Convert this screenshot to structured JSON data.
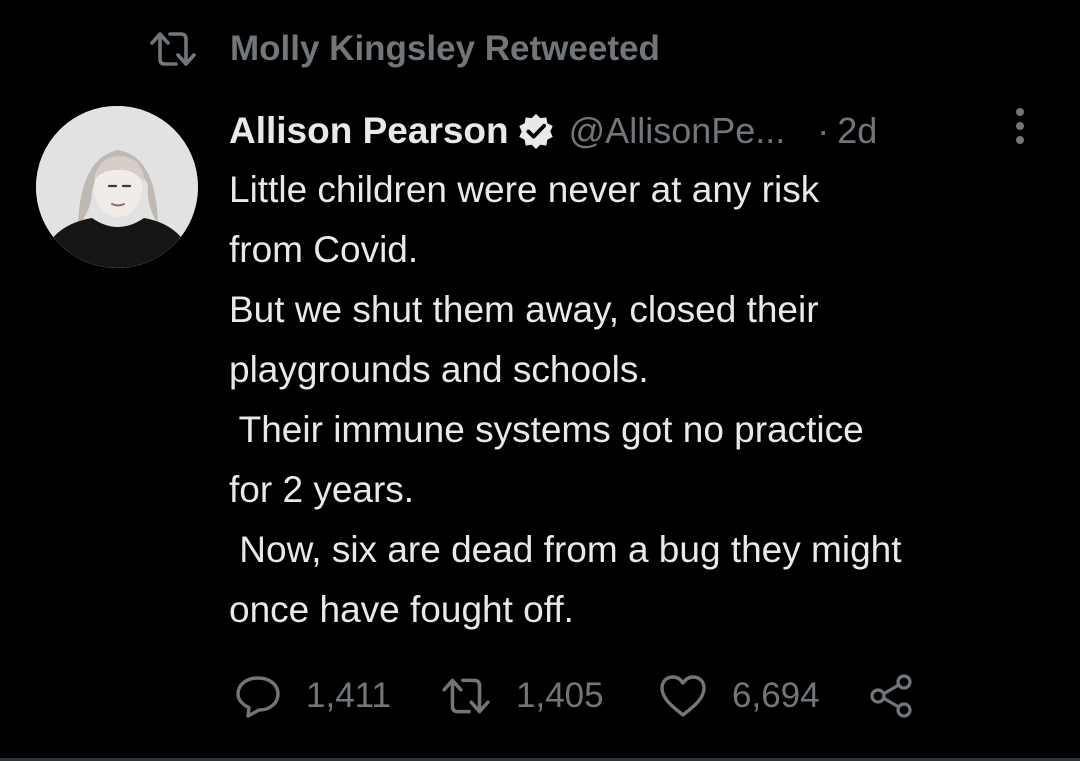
{
  "retweet_context": {
    "text": "Molly Kingsley Retweeted",
    "icon": "retweet-icon"
  },
  "tweet": {
    "author_name": "Allison Pearson",
    "verified": true,
    "handle": "@AllisonPe...",
    "separator": "·",
    "timestamp": "2d",
    "lines": [
      "Little children were never at any risk",
      "from Covid.",
      "But we shut them away, closed their",
      "playgrounds and schools.",
      " Their immune systems got no practice",
      "for 2 years.",
      " Now, six are dead from a bug they might",
      "once have fought off."
    ]
  },
  "actions": {
    "reply": {
      "icon": "reply-icon",
      "count": "1,411"
    },
    "retweet": {
      "icon": "retweet-icon",
      "count": "1,405"
    },
    "like": {
      "icon": "heart-icon",
      "count": "6,694"
    },
    "share": {
      "icon": "share-icon"
    }
  },
  "colors": {
    "background": "#000000",
    "primary_text": "#e7e9ea",
    "secondary_text": "#71767b"
  }
}
